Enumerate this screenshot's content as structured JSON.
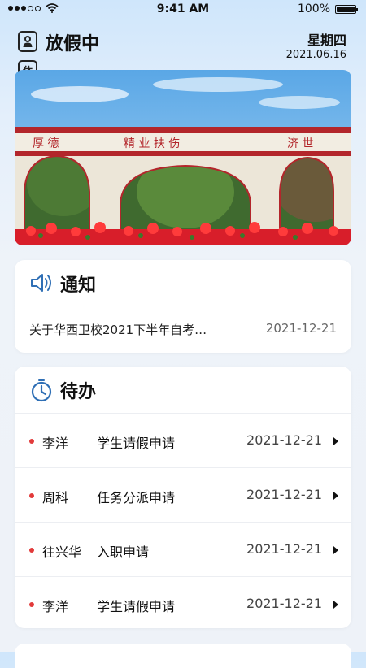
{
  "status_bar": {
    "time": "9:41 AM",
    "battery": "100%",
    "battery_level": 1.0,
    "signal_icon": "signal-dots-icon",
    "wifi_icon": "wifi-icon"
  },
  "header": {
    "title": "放假中",
    "badge": "休",
    "weekday": "星期四",
    "date": "2021.06.16"
  },
  "banner": {
    "gate_text_left": "厚 德",
    "gate_text_middle": "精 业 扶 伤",
    "gate_text_right": "济 世"
  },
  "notice": {
    "title": "通知",
    "icon": "speaker-icon",
    "item": {
      "text": "关于华西卫校2021下半年自考…",
      "date": "2021-12-21"
    }
  },
  "todo": {
    "title": "待办",
    "icon": "stopwatch-icon",
    "items": [
      {
        "name": "李洋",
        "type": "学生请假申请",
        "date": "2021-12-21"
      },
      {
        "name": "周科",
        "type": "任务分派申请",
        "date": "2021-12-21"
      },
      {
        "name": "往兴华",
        "type": "入职申请",
        "date": "2021-12-21"
      },
      {
        "name": "李洋",
        "type": "学生请假申请",
        "date": "2021-12-21"
      }
    ]
  },
  "colors": {
    "accent": "#2f6fb5",
    "dot": "#e23a3a",
    "gate_red": "#b3262b"
  }
}
